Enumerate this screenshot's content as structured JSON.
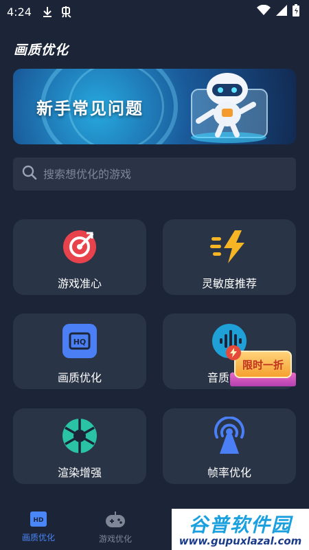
{
  "status_bar": {
    "time": "4:24"
  },
  "app": {
    "title": "画质优化"
  },
  "banner": {
    "title": "新手常见问题"
  },
  "search": {
    "placeholder": "搜索想优化的游戏"
  },
  "features": [
    {
      "label": "游戏准心",
      "icon": "crosshair-target-icon"
    },
    {
      "label": "灵敏度推荐",
      "icon": "lightning-speed-icon"
    },
    {
      "label": "画质优化",
      "icon": "hd-quality-icon"
    },
    {
      "label": "音质优化",
      "icon": "sound-wave-icon"
    },
    {
      "label": "渲染增强",
      "icon": "aperture-icon"
    },
    {
      "label": "帧率优化",
      "icon": "broadcast-tower-icon"
    }
  ],
  "promo_badge": {
    "text": "限时一折"
  },
  "tabs": [
    {
      "label": "画质优化",
      "icon": "hd-tab-icon",
      "active": true
    },
    {
      "label": "游戏优化",
      "icon": "gamepad-tab-icon",
      "active": false
    }
  ],
  "watermark": {
    "name": "谷普软件园",
    "url": "www.gupuxlazal.com"
  },
  "colors": {
    "background": "#1c2538",
    "card": "#2a3447",
    "accent": "#4a86f7"
  }
}
